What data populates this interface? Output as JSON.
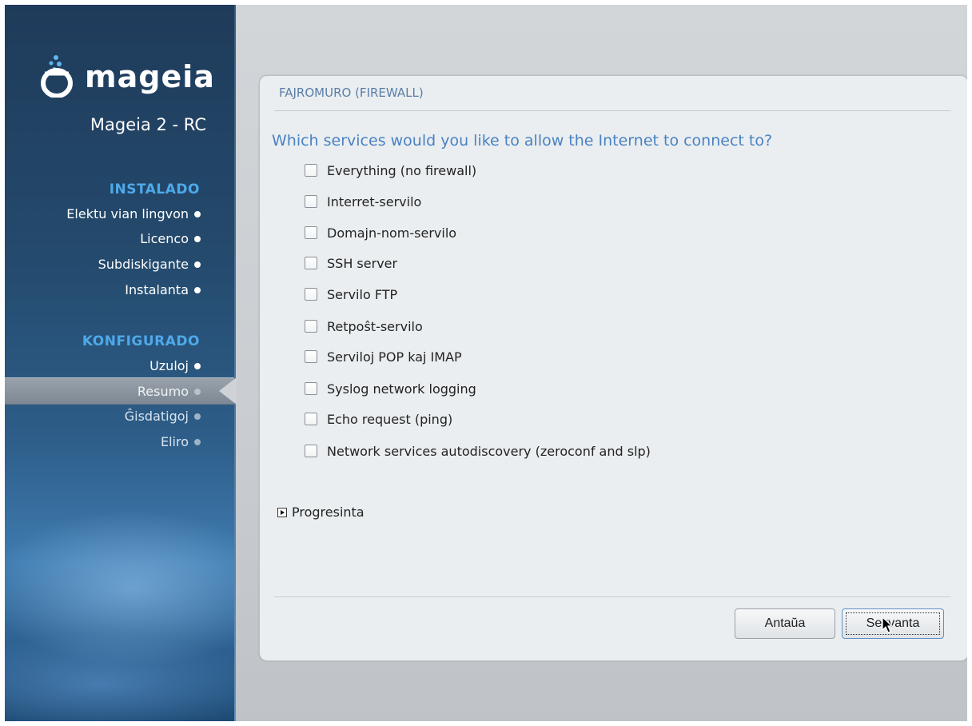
{
  "sidebar": {
    "logo_text": "mageia",
    "version": "Mageia 2 - RC",
    "sections": [
      {
        "title": "INSTALADO",
        "steps": [
          "Elektu vian lingvon",
          "Licenco",
          "Subdiskigante",
          "Instalanta"
        ]
      },
      {
        "title": "KONFIGURADO",
        "steps": [
          "Uzuloj",
          "Resumo",
          "Ĝisdatigoj",
          "Eliro"
        ]
      }
    ],
    "current_step": "Resumo"
  },
  "panel": {
    "title": "FAJROMURO (FIREWALL)",
    "question": "Which services would you like to allow the Internet to connect to?",
    "options": [
      {
        "label": "Everything (no firewall)",
        "checked": false
      },
      {
        "label": "Interret-servilo",
        "checked": false
      },
      {
        "label": "Domajn-nom-servilo",
        "checked": false
      },
      {
        "label": "SSH server",
        "checked": false
      },
      {
        "label": "Servilo FTP",
        "checked": false
      },
      {
        "label": "Retpoŝt-servilo",
        "checked": false
      },
      {
        "label": "Serviloj POP kaj IMAP",
        "checked": false
      },
      {
        "label": "Syslog network logging",
        "checked": false
      },
      {
        "label": "Echo request (ping)",
        "checked": false
      },
      {
        "label": "Network services autodiscovery (zeroconf and slp)",
        "checked": false
      }
    ],
    "advanced_label": "Progresinta",
    "buttons": {
      "previous": "Antaŭa",
      "next": "Sekvanta"
    }
  },
  "colors": {
    "accent": "#4a82c3",
    "section_title": "#4ea9ea",
    "panel_bg": "#eaeef0"
  }
}
